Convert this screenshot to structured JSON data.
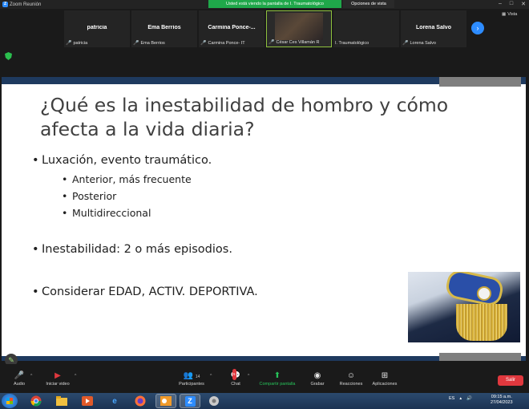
{
  "window": {
    "title": "Zoom Reunión",
    "share_banner": "Usted está viendo la pantalla de I. Traumatológico",
    "view_options": "Opciones de vista",
    "view_label": "Vista"
  },
  "participants": [
    {
      "name": "patricia",
      "label": "patricia",
      "muted": true
    },
    {
      "name": "Ema Berrios",
      "label": "Ema Berrios",
      "muted": true
    },
    {
      "name": "Carmina  Ponce-...",
      "label": "Carmina Ponce- IT",
      "muted": true
    },
    {
      "name": "",
      "label": "César Ces Villamán R",
      "muted": true,
      "video": true
    },
    {
      "name": "",
      "label": "I. Traumatológico",
      "muted": false
    },
    {
      "name": "Lorena Salvo",
      "label": "Lorena Salvo",
      "muted": true
    }
  ],
  "slide": {
    "title": "¿Qué es la inestabilidad de hombro y cómo afecta a la vida diaria?",
    "bullets": [
      {
        "level": 1,
        "text": "Luxación, evento traumático."
      },
      {
        "level": 2,
        "text": "Anterior, más frecuente"
      },
      {
        "level": 2,
        "text": "Posterior"
      },
      {
        "level": 2,
        "text": "Multidireccional"
      },
      {
        "level": 1,
        "text": "Inestabilidad: 2 o más episodios."
      },
      {
        "level": 1,
        "text": "Considerar EDAD, ACTIV. DEPORTIVA."
      }
    ]
  },
  "controls": {
    "audio": "Audio",
    "video": "Iniciar video",
    "participants": "Participantes",
    "participants_count": "14",
    "chat": "Chat",
    "chat_badge": "5",
    "share": "Compartir pantalla",
    "record": "Grabar",
    "reactions": "Reacciones",
    "apps": "Aplicaciones",
    "leave": "Salir"
  },
  "taskbar": {
    "lang": "ES",
    "time": "09:15 a.m.",
    "date": "27/04/2023"
  },
  "colors": {
    "zoom_blue": "#2d8cff",
    "share_green": "#1fa84a",
    "leave_red": "#e0383e",
    "slide_navy": "#1e3a5f"
  }
}
